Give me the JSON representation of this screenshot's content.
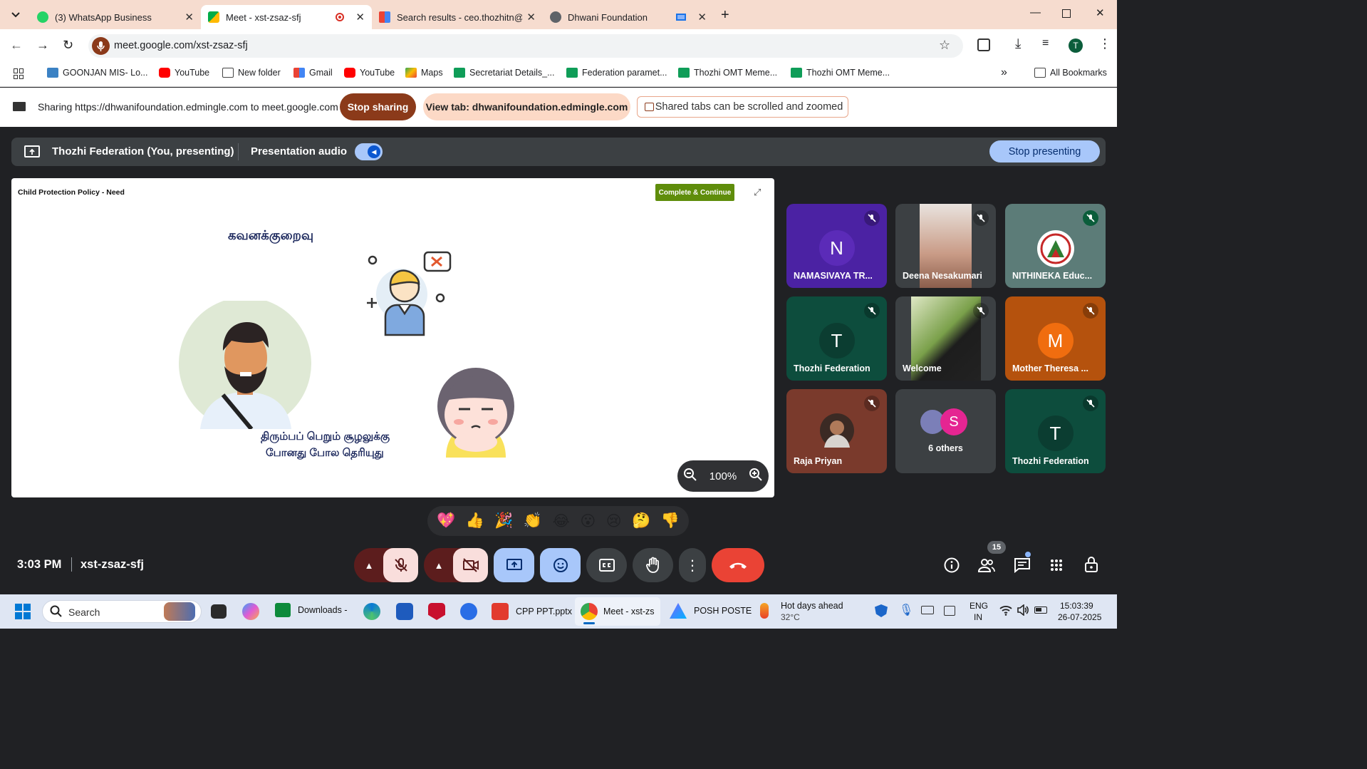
{
  "browser": {
    "tabs": [
      {
        "title": "(3) WhatsApp Business"
      },
      {
        "title": "Meet - xst-zsaz-sfj"
      },
      {
        "title": "Search results - ceo.thozhitn@g"
      },
      {
        "title": "Dhwani Foundation"
      }
    ],
    "url": "meet.google.com/xst-zsaz-sfj",
    "profile_initial": "T",
    "bookmarks": [
      {
        "label": "GOONJAN MIS- Lo..."
      },
      {
        "label": "YouTube"
      },
      {
        "label": "New folder"
      },
      {
        "label": "Gmail"
      },
      {
        "label": "YouTube"
      },
      {
        "label": "Maps"
      },
      {
        "label": "Secretariat Details_..."
      },
      {
        "label": "Federation paramet..."
      },
      {
        "label": "Thozhi OMT Meme..."
      },
      {
        "label": "Thozhi OMT Meme..."
      }
    ],
    "all_bookmarks": "All Bookmarks"
  },
  "share": {
    "text": "Sharing https://dhwanifoundation.edmingle.com to meet.google.com",
    "stop_label": "Stop sharing",
    "view_tab_label": "View tab: dhwanifoundation.edmingle.com",
    "hint": "Shared tabs can be scrolled and zoomed"
  },
  "meet": {
    "presenter": "Thozhi Federation (You, presenting)",
    "presentation_audio": "Presentation audio",
    "stop_presenting": "Stop presenting",
    "slide": {
      "title": "Child Protection Policy - Need",
      "complete_btn": "Complete & Continue",
      "heading": "கவனக்குறைவு",
      "caption_line1": "திரும்பப் பெறும் சூழலுக்கு",
      "caption_line2": "போனது போல தெரியுது",
      "zoom": "100%"
    },
    "participants": [
      {
        "name": "NAMASIVAYA TR...",
        "initial": "N"
      },
      {
        "name": "Deena Nesakumari"
      },
      {
        "name": "NITHINEKA Educ..."
      },
      {
        "name": "Thozhi Federation",
        "initial": "T"
      },
      {
        "name": "Welcome"
      },
      {
        "name": "Mother Theresa ...",
        "initial": "M"
      },
      {
        "name": "Raja Priyan"
      },
      {
        "name": "6 others",
        "initial": "S"
      },
      {
        "name": "Thozhi Federation",
        "initial": "T"
      }
    ],
    "reactions": [
      "💖",
      "👍",
      "🎉",
      "👏",
      "😂",
      "😮",
      "😢",
      "🤔",
      "👎"
    ],
    "time": "3:03 PM",
    "meeting_code": "xst-zsaz-sfj",
    "people_count": "15"
  },
  "taskbar": {
    "search": "Search",
    "apps": [
      {
        "label": "Downloads -"
      },
      {
        "label": "CPP PPT.pptx"
      },
      {
        "label": "Meet - xst-zs"
      },
      {
        "label": "POSH POSTE"
      }
    ],
    "weather_title": "Hot days ahead",
    "weather_temp": "32°C",
    "lang1": "ENG",
    "lang2": "IN",
    "clock_time": "15:03:39",
    "clock_date": "26-07-2025"
  },
  "colors": {
    "tabstrip": "#f6dccf",
    "stop_sharing": "#8b3a1a",
    "view_tab": "#fcd9c6",
    "stop_presenting": "#a8c7fa",
    "end_call": "#ea4335",
    "complete_btn": "#5f8d0b"
  }
}
